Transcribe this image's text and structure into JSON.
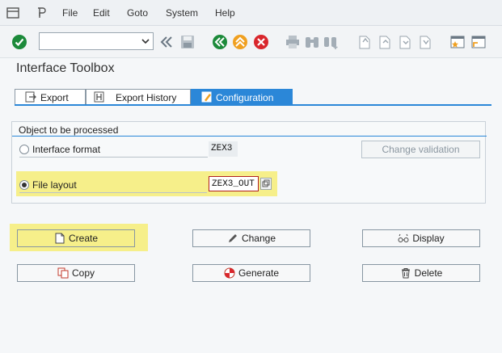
{
  "menu": {
    "items": [
      "File",
      "Edit",
      "Goto",
      "System",
      "Help"
    ]
  },
  "page": {
    "title": "Interface Toolbox"
  },
  "tabs": [
    {
      "label": "Export",
      "active": false
    },
    {
      "label": "Export History",
      "active": false
    },
    {
      "label": "Configuration",
      "active": true
    }
  ],
  "group": {
    "title": "Object to be processed",
    "interface_format_label": "Interface format",
    "interface_format_value": "ZEX3",
    "change_validation_label": "Change validation",
    "file_layout_label": "File layout",
    "file_layout_value": "ZEX3_OUT",
    "selected": "File layout"
  },
  "buttons": {
    "create": "Create",
    "change": "Change",
    "display": "Display",
    "copy": "Copy",
    "generate": "Generate",
    "delete": "Delete"
  },
  "colors": {
    "accent": "#2b87d8",
    "highlight": "#f6ef8a",
    "check_green": "#1c8a3a",
    "cancel_red": "#d9262c",
    "up_orange": "#f0a020"
  }
}
